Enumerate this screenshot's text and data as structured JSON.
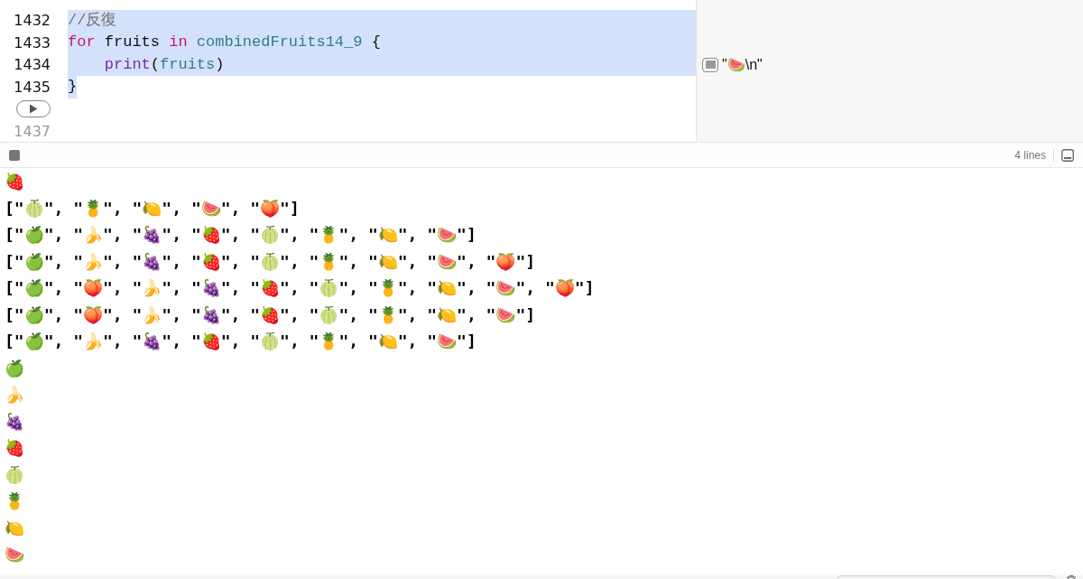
{
  "editor": {
    "lines": [
      {
        "number": "1432",
        "selected": true,
        "tokens": [
          {
            "kind": "comment",
            "text": "//反復"
          }
        ]
      },
      {
        "number": "1433",
        "selected": true,
        "tokens": [
          {
            "kind": "keyword",
            "text": "for"
          },
          {
            "kind": "plain",
            "text": " fruits "
          },
          {
            "kind": "keyword",
            "text": "in"
          },
          {
            "kind": "variable",
            "text": " combinedFruits14_9"
          },
          {
            "kind": "plain",
            "text": " {"
          }
        ]
      },
      {
        "number": "1434",
        "selected": true,
        "tokens": [
          {
            "kind": "function",
            "text": "    print"
          },
          {
            "kind": "plain",
            "text": "("
          },
          {
            "kind": "variable",
            "text": "fruits"
          },
          {
            "kind": "plain",
            "text": ")"
          }
        ]
      },
      {
        "number": "1435",
        "selected": true,
        "tokens": [
          {
            "kind": "plain",
            "text": "}"
          }
        ]
      },
      {
        "kind": "run",
        "selected": false
      },
      {
        "number": "1437",
        "selected": false
      }
    ]
  },
  "results": [
    {
      "text": "\"🍉\\n\""
    }
  ],
  "console": {
    "line_count": "4 lines",
    "output": [
      "🍓",
      "[\"🍈\", \"🍍\", \"🍋\", \"🍉\", \"🍑\"]",
      "[\"🍏\", \"🍌\", \"🍇\", \"🍓\", \"🍈\", \"🍍\", \"🍋\", \"🍉\"]",
      "[\"🍏\", \"🍌\", \"🍇\", \"🍓\", \"🍈\", \"🍍\", \"🍋\", \"🍉\", \"🍑\"]",
      "[\"🍏\", \"🍑\", \"🍌\", \"🍇\", \"🍓\", \"🍈\", \"🍍\", \"🍋\", \"🍉\", \"🍑\"]",
      "[\"🍏\", \"🍑\", \"🍌\", \"🍇\", \"🍓\", \"🍈\", \"🍍\", \"🍋\", \"🍉\"]",
      "[\"🍏\", \"🍌\", \"🍇\", \"🍓\", \"🍈\", \"🍍\", \"🍋\", \"🍉\"]",
      "🍏",
      "🍌",
      "🍇",
      "🍓",
      "🍈",
      "🍍",
      "🍋",
      "🍉"
    ]
  }
}
